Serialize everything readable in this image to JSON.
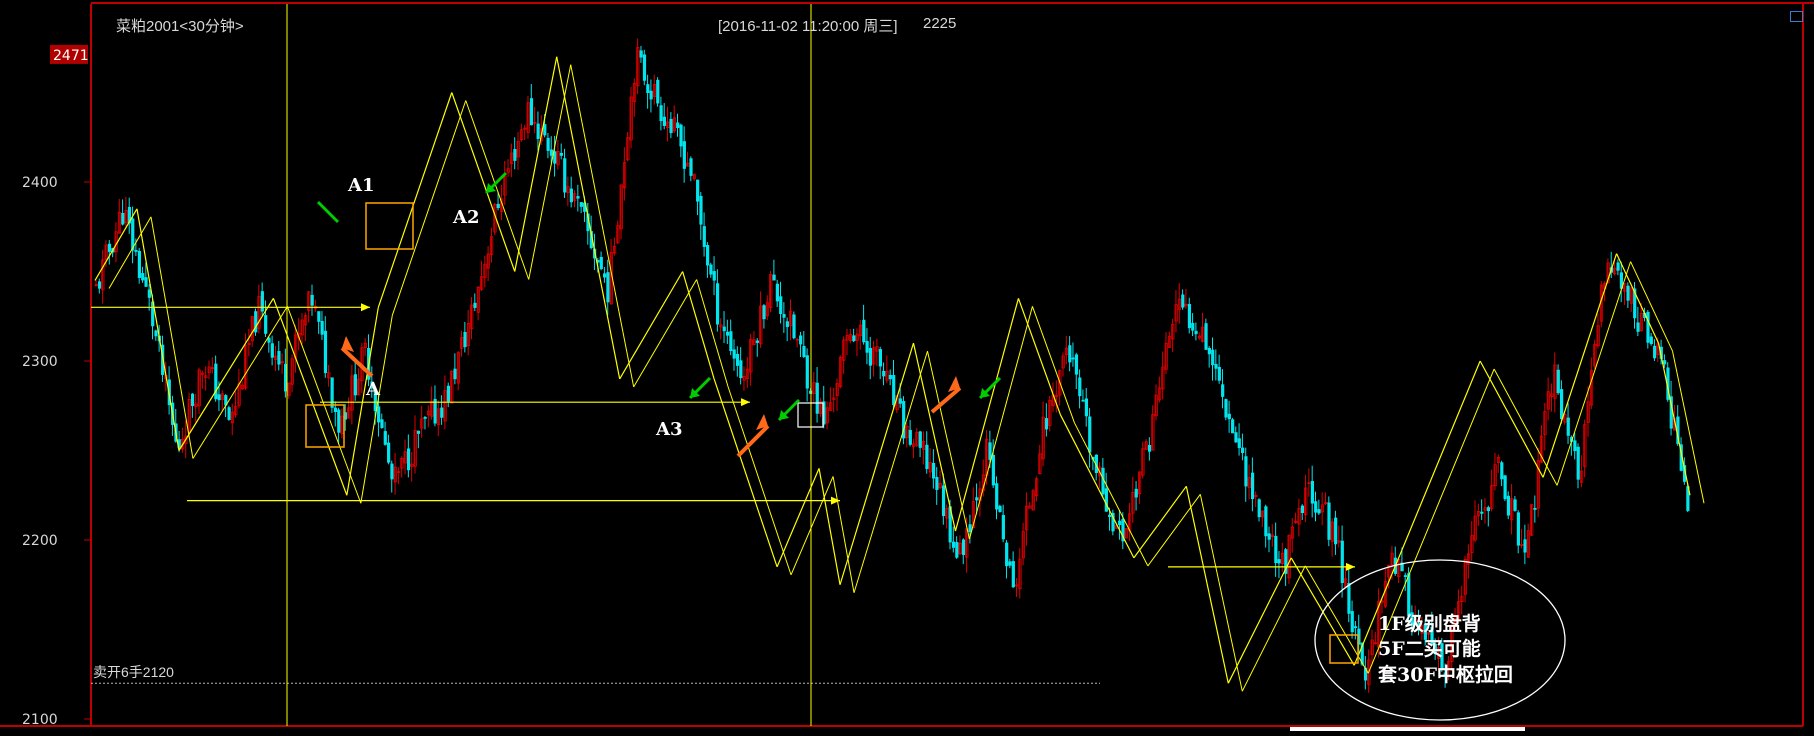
{
  "header": {
    "symbol": "菜粕2001<30分钟>",
    "cursor_info": "[2016-11-02  11:20:00 周三]",
    "cursor_value": "2225"
  },
  "price_axis": {
    "ticks": [
      2100,
      2200,
      2300,
      2400
    ],
    "high_tag": "2471"
  },
  "order_line": {
    "label": "卖开6手2120",
    "price": 2120
  },
  "colors": {
    "background": "#000000",
    "frame": "#c00000",
    "up_candle": "#e00000",
    "down_candle": "#00e5ee",
    "trend_lines": "#ffff00",
    "text": "#d8d8d8",
    "green_arrow": "#00cc00",
    "orange_arrow": "#ff6a1a",
    "box": "#ffa500"
  },
  "annotations": {
    "A1": "A1",
    "A2": "A2",
    "A": "A",
    "A3": "A3",
    "note_line1": "1F级别盘背",
    "note_line2": "5F二买可能",
    "note_line3": "套30F中枢拉回"
  },
  "chart_data": {
    "type": "candlestick",
    "title": "菜粕2001<30分钟>",
    "ylim": [
      2100,
      2471
    ],
    "y_ticks": [
      2100,
      2200,
      2300,
      2400
    ],
    "grid": false,
    "price_path": [
      2340,
      2385,
      2330,
      2250,
      2300,
      2265,
      2330,
      2290,
      2335,
      2265,
      2305,
      2230,
      2260,
      2280,
      2330,
      2395,
      2440,
      2415,
      2380,
      2340,
      2470,
      2440,
      2410,
      2330,
      2290,
      2345,
      2310,
      2265,
      2320,
      2300,
      2260,
      2240,
      2190,
      2250,
      2170,
      2255,
      2310,
      2240,
      2200,
      2255,
      2330,
      2320,
      2270,
      2220,
      2185,
      2230,
      2200,
      2120,
      2195,
      2150,
      2125,
      2200,
      2240,
      2190,
      2295,
      2235,
      2360,
      2330,
      2300,
      2225
    ],
    "zigzag_vertices": [
      [
        0.0,
        2345
      ],
      [
        0.04,
        2385
      ],
      [
        0.08,
        2250
      ],
      [
        0.17,
        2335
      ],
      [
        0.24,
        2225
      ],
      [
        0.27,
        2330
      ],
      [
        0.34,
        2450
      ],
      [
        0.4,
        2350
      ],
      [
        0.44,
        2470
      ],
      [
        0.5,
        2290
      ],
      [
        0.56,
        2350
      ],
      [
        0.59,
        2290
      ],
      [
        0.65,
        2185
      ],
      [
        0.69,
        2240
      ],
      [
        0.71,
        2175
      ],
      [
        0.78,
        2310
      ],
      [
        0.82,
        2205
      ],
      [
        0.88,
        2335
      ],
      [
        0.92,
        2270
      ],
      [
        0.99,
        2190
      ],
      [
        1.04,
        2230
      ],
      [
        1.08,
        2120
      ],
      [
        1.14,
        2190
      ],
      [
        1.2,
        2130
      ],
      [
        1.32,
        2300
      ],
      [
        1.38,
        2235
      ],
      [
        1.45,
        2360
      ],
      [
        1.49,
        2310
      ],
      [
        1.52,
        2225
      ]
    ],
    "horizontal_levels": [
      2330,
      2277,
      2222,
      2185
    ],
    "cursor_price": 2225
  }
}
